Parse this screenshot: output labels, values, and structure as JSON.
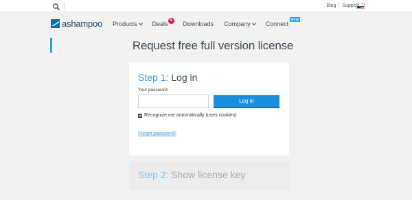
{
  "topbar": {
    "search_icon": "search-icon",
    "links": [
      "Blog",
      "Support"
    ],
    "flag_icon": "us-flag-icon"
  },
  "nav": {
    "logo_text": "ashampoo",
    "items": [
      {
        "label": "Products",
        "has_dropdown": true
      },
      {
        "label": "Deals",
        "badge": "%"
      },
      {
        "label": "Downloads"
      },
      {
        "label": "Company",
        "has_dropdown": true
      },
      {
        "label": "Connect",
        "badge": "NEW"
      }
    ]
  },
  "page": {
    "title": "Request free full version license"
  },
  "step1": {
    "number": "Step 1:",
    "text": "Log in",
    "password_label": "Your password:",
    "password_value": "",
    "login_button": "Log in",
    "remember_label": "Recognize me automatically (uses cookies)",
    "remember_checked": true,
    "forgot_link": "Forgot password?"
  },
  "step2": {
    "number": "Step 2:",
    "text": "Show license key"
  },
  "colors": {
    "accent": "#2aa3e6",
    "button": "#1a8fdd",
    "deal_badge": "#e3154f",
    "background": "#f2f2f2"
  }
}
